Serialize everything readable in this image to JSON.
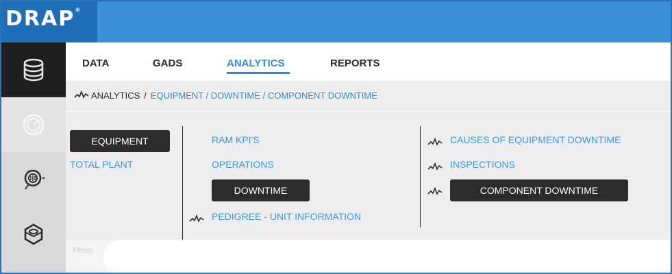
{
  "app": {
    "logo": "DRAP",
    "logo_mark": "®"
  },
  "leftnav": {
    "items": [
      {
        "icon": "database-icon",
        "active": true
      },
      {
        "icon": "gauge-icon",
        "active": false
      },
      {
        "icon": "valve-icon",
        "active": false
      },
      {
        "icon": "hex-nut-icon",
        "active": false
      }
    ]
  },
  "tabs": [
    {
      "label": "DATA",
      "active": false
    },
    {
      "label": "GADS",
      "active": false
    },
    {
      "label": "ANALYTICS",
      "active": true
    },
    {
      "label": "REPORTS",
      "active": false
    }
  ],
  "breadcrumb": {
    "root": "ANALYTICS",
    "separator": "/",
    "path": "EQUIPMENT / DOWNTIME / COMPONENT DOWNTIME"
  },
  "column1": {
    "selected": "EQUIPMENT",
    "link": "TOTAL PLANT"
  },
  "column2": {
    "link1": "RAM KPI'S",
    "link2": "OPERATIONS",
    "selected": "DOWNTIME",
    "link3": "PEDIGREE - UNIT INFORMATION"
  },
  "column3": {
    "link1": "CAUSES OF EQUIPMENT DOWNTIME",
    "link2": "INSPECTIONS",
    "selected": "COMPONENT DOWNTIME"
  },
  "filters": {
    "label": "Filters"
  },
  "colors": {
    "accent": "#2f8ad8",
    "topbar": "#3a8fd6",
    "dark_button": "#2c2c2c",
    "nav_active": "#1f1f1f"
  }
}
